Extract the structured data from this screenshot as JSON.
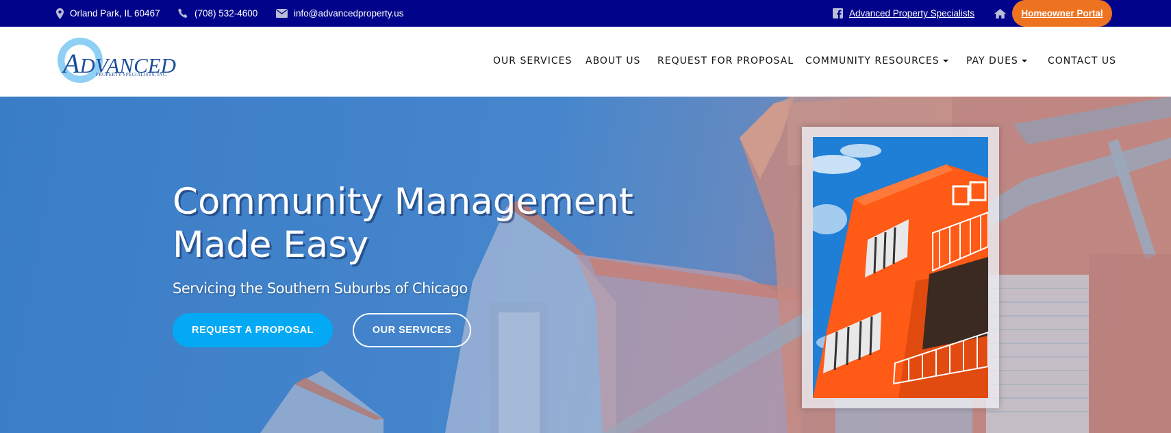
{
  "topbar": {
    "location": "Orland Park, IL 60467",
    "phone": "(708) 532-4600",
    "email": "info@advancedproperty.us",
    "facebook_link": "Advanced Property Specialists",
    "portal_button": "Homeowner Portal",
    "colors": {
      "background": "#01048b",
      "portal": "#ee7320"
    },
    "icons": [
      "map-pin-icon",
      "phone-icon",
      "envelope-icon",
      "facebook-icon",
      "home-icon"
    ]
  },
  "header": {
    "logo": {
      "word": "DVANCED",
      "initial": "A",
      "subtitle": "PROPERTY SPECIALISTS, INC."
    },
    "nav": [
      {
        "label": "OUR SERVICES",
        "dropdown": false
      },
      {
        "label": "ABOUT US",
        "dropdown": false
      },
      {
        "label": "REQUEST FOR PROPOSAL",
        "dropdown": false
      },
      {
        "label": "COMMUNITY RESOURCES",
        "dropdown": true
      },
      {
        "label": "PAY DUES",
        "dropdown": true
      },
      {
        "label": "CONTACT US",
        "dropdown": false
      }
    ]
  },
  "hero": {
    "title": "Community Management Made Easy",
    "subtitle": "Servicing the Southern Suburbs of Chicago",
    "primary_button": "REQUEST A PROPOSAL",
    "secondary_button": "OUR SERVICES",
    "colors": {
      "primary_button": "#03a9f4"
    }
  }
}
